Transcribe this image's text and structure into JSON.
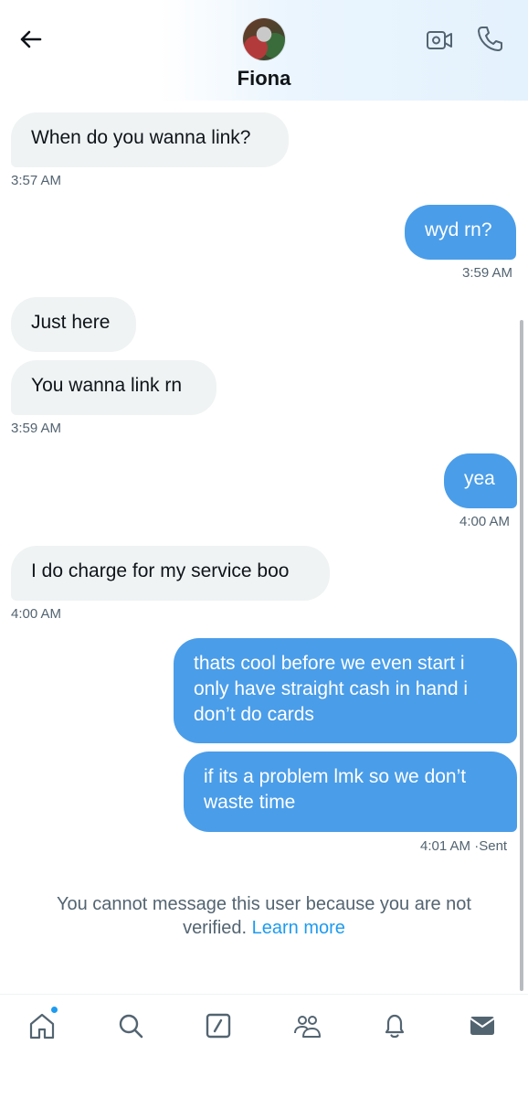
{
  "header": {
    "contact_name": "Fiona",
    "icons": {
      "back": "back-arrow-icon",
      "video": "video-call-icon",
      "call": "phone-icon"
    }
  },
  "messages": [
    {
      "direction": "in",
      "text": "When do you wanna link?",
      "time": "3:57 AM"
    },
    {
      "direction": "out",
      "text": "wyd rn?",
      "time": "3:59 AM"
    },
    {
      "direction": "in",
      "text": "Just here"
    },
    {
      "direction": "in",
      "text": "You wanna link rn",
      "time": "3:59 AM"
    },
    {
      "direction": "out",
      "text": "yea",
      "time": "4:00 AM"
    },
    {
      "direction": "in",
      "text": "I do charge for my service boo",
      "time": "4:00 AM"
    },
    {
      "direction": "out",
      "text": "thats cool before we even start i only have straight cash in hand i don’t do cards"
    },
    {
      "direction": "out",
      "text": "if its a problem lmk so we don’t waste time",
      "time": "4:01 AM",
      "status": "Sent"
    }
  ],
  "notice": {
    "text": "You cannot message this user because you are not verified.",
    "link": "Learn more"
  },
  "nav": {
    "items": [
      "home-icon",
      "search-icon",
      "grok-icon",
      "communities-icon",
      "notifications-icon",
      "messages-icon"
    ],
    "accent": "#1d9bf0"
  },
  "colors": {
    "outgoing_bubble": "#4a9de9",
    "incoming_bubble": "#eff3f4",
    "link": "#1d9bf0"
  }
}
